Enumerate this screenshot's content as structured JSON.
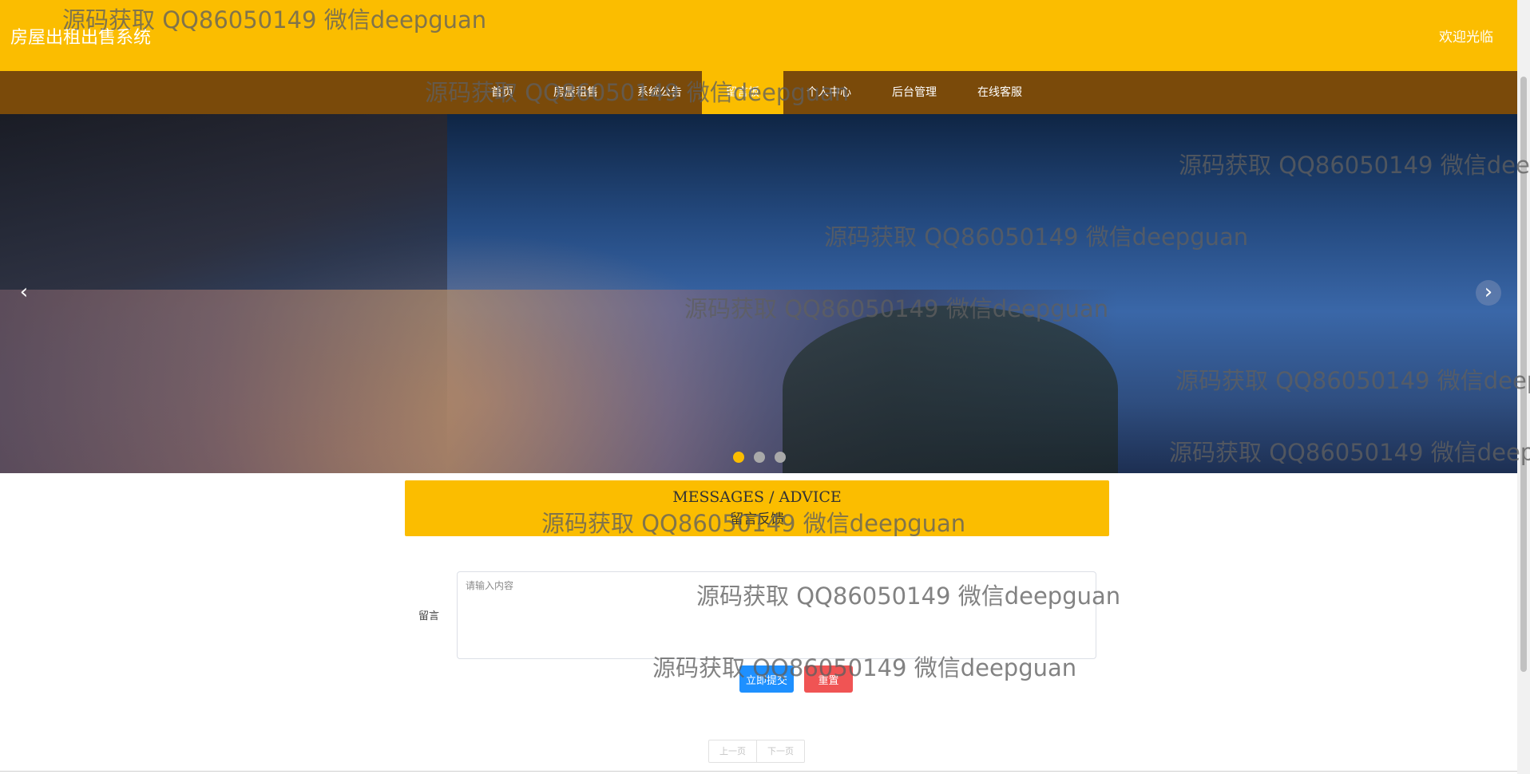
{
  "header": {
    "site_title": "房屋出租出售系统",
    "welcome_text": "欢迎光临"
  },
  "nav": {
    "items": [
      {
        "label": "首页"
      },
      {
        "label": "房屋租售"
      },
      {
        "label": "系统公告"
      },
      {
        "label": "留言板"
      },
      {
        "label": "个人中心"
      },
      {
        "label": "后台管理"
      },
      {
        "label": "在线客服"
      }
    ],
    "active_index": 3
  },
  "carousel": {
    "prev_label": "‹",
    "next_label": "›",
    "slide_count": 3,
    "active_slide": 1
  },
  "section": {
    "title_en": "MESSAGES / ADVICE",
    "title_cn": "留言反馈"
  },
  "form": {
    "message_label": "留言",
    "message_placeholder": "请输入内容",
    "message_value": "",
    "submit_label": "立即提交",
    "reset_label": "重置"
  },
  "pagination": {
    "prev_label": "上一页",
    "next_label": "下一页"
  },
  "watermark": {
    "text": "源码获取 QQ86050149 微信deepguan"
  },
  "colors": {
    "brand_yellow": "#fbbd00",
    "nav_brown": "#7a4a0a",
    "submit_blue": "#1e90ff",
    "reset_red": "#f05454"
  }
}
